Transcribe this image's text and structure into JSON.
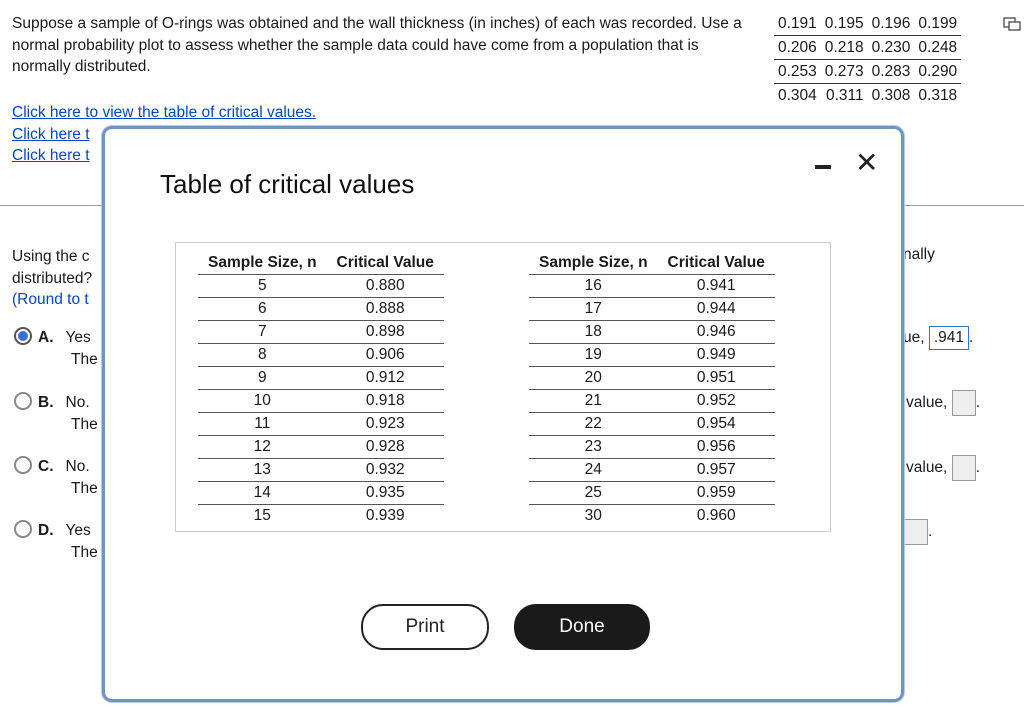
{
  "question": {
    "text": "Suppose a sample of O-rings was obtained and the wall thickness (in inches) of each was recorded. Use a normal probability plot to assess whether the sample data could have come from a population that is normally distributed."
  },
  "sample_data": [
    [
      "0.191",
      "0.195",
      "0.196",
      "0.199"
    ],
    [
      "0.206",
      "0.218",
      "0.230",
      "0.248"
    ],
    [
      "0.253",
      "0.273",
      "0.283",
      "0.290"
    ],
    [
      "0.304",
      "0.311",
      "0.308",
      "0.318"
    ]
  ],
  "links": {
    "critical_values": "Click here to view the table of critical values.",
    "link2": "Click here t",
    "link3": "Click here t"
  },
  "part2": {
    "line1": "Using the c",
    "line2": "distributed?",
    "line3": "(Round to t",
    "right_fragment": "nally"
  },
  "options": [
    {
      "letter": "A.",
      "line1": "Yes",
      "line2": "The",
      "right": "ue,",
      "value": ".941",
      "selected": true
    },
    {
      "letter": "B.",
      "line1": "No.",
      "line2": "The",
      "right": "value,",
      "value": "",
      "selected": false
    },
    {
      "letter": "C.",
      "line1": "No.",
      "line2": "The",
      "right": "value,",
      "value": "",
      "selected": false
    },
    {
      "letter": "D.",
      "line1": "Yes",
      "line2": "The",
      "right": "",
      "value": "",
      "selected": false
    }
  ],
  "modal": {
    "title": "Table of critical values",
    "headers": [
      "Sample Size, n",
      "Critical Value"
    ],
    "left_rows": [
      [
        "5",
        "0.880"
      ],
      [
        "6",
        "0.888"
      ],
      [
        "7",
        "0.898"
      ],
      [
        "8",
        "0.906"
      ],
      [
        "9",
        "0.912"
      ],
      [
        "10",
        "0.918"
      ],
      [
        "11",
        "0.923"
      ],
      [
        "12",
        "0.928"
      ],
      [
        "13",
        "0.932"
      ],
      [
        "14",
        "0.935"
      ],
      [
        "15",
        "0.939"
      ]
    ],
    "right_rows": [
      [
        "16",
        "0.941"
      ],
      [
        "17",
        "0.944"
      ],
      [
        "18",
        "0.946"
      ],
      [
        "19",
        "0.949"
      ],
      [
        "20",
        "0.951"
      ],
      [
        "21",
        "0.952"
      ],
      [
        "22",
        "0.954"
      ],
      [
        "23",
        "0.956"
      ],
      [
        "24",
        "0.957"
      ],
      [
        "25",
        "0.959"
      ],
      [
        "30",
        "0.960"
      ]
    ],
    "print_label": "Print",
    "done_label": "Done",
    "close_glyph": "✕"
  },
  "colors": {
    "link": "#0645c8",
    "modal_border": "#6e93c7",
    "radio_selected": "#3a6ed8"
  }
}
